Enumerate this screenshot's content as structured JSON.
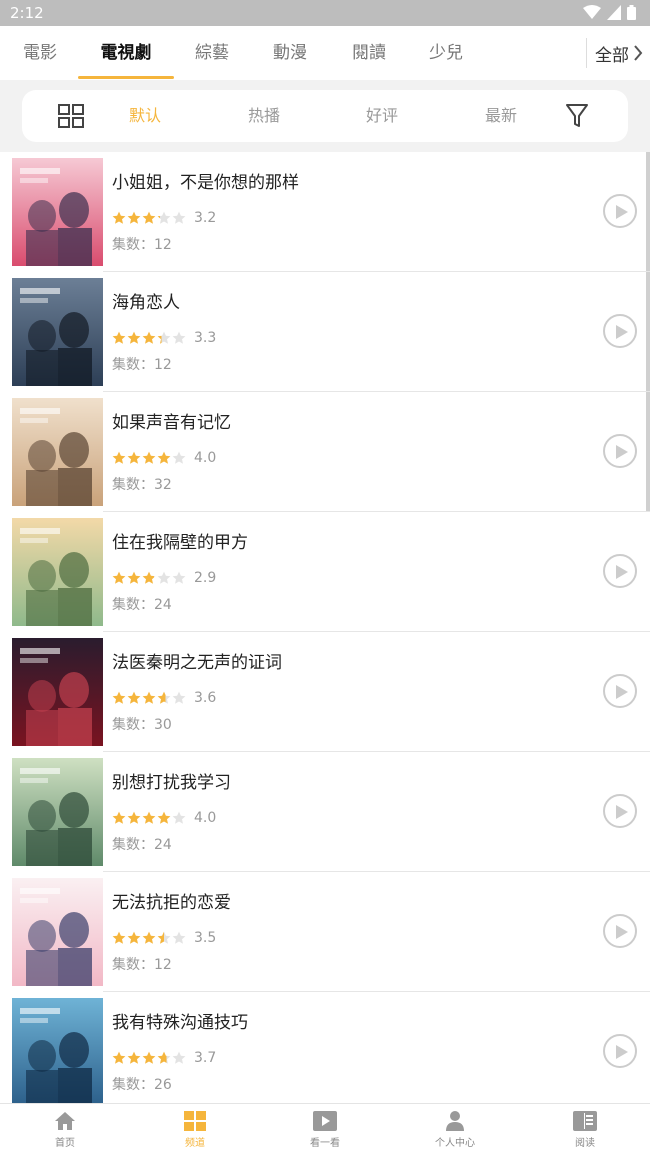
{
  "status_bar": {
    "time": "2:12"
  },
  "category_tabs": {
    "items": [
      "電影",
      "電視劇",
      "綜藝",
      "動漫",
      "閱讀",
      "少兒"
    ],
    "active_index": 1,
    "all_label": "全部"
  },
  "sort_bar": {
    "items": [
      "默认",
      "热播",
      "好评",
      "最新"
    ],
    "active_index": 0
  },
  "shows": [
    {
      "title": "小姐姐，不是你想的那样",
      "rating": 3.2,
      "rating_text": "3.2",
      "episodes": "集数：12"
    },
    {
      "title": "海角恋人",
      "rating": 3.3,
      "rating_text": "3.3",
      "episodes": "集数：12"
    },
    {
      "title": "如果声音有记忆",
      "rating": 4.0,
      "rating_text": "4.0",
      "episodes": "集数：32"
    },
    {
      "title": "住在我隔壁的甲方",
      "rating": 2.9,
      "rating_text": "2.9",
      "episodes": "集数：24"
    },
    {
      "title": "法医秦明之无声的证词",
      "rating": 3.6,
      "rating_text": "3.6",
      "episodes": "集数：30"
    },
    {
      "title": "别想打扰我学习",
      "rating": 4.0,
      "rating_text": "4.0",
      "episodes": "集数：24"
    },
    {
      "title": "无法抗拒的恋爱",
      "rating": 3.5,
      "rating_text": "3.5",
      "episodes": "集数：12"
    },
    {
      "title": "我有特殊沟通技巧",
      "rating": 3.7,
      "rating_text": "3.7",
      "episodes": "集数：26"
    }
  ],
  "bottom_nav": {
    "items": [
      {
        "label": "首页",
        "icon": "home-icon"
      },
      {
        "label": "频道",
        "icon": "channel-grid-icon"
      },
      {
        "label": "看一看",
        "icon": "video-play-icon"
      },
      {
        "label": "个人中心",
        "icon": "user-icon"
      },
      {
        "label": "阅读",
        "icon": "book-icon"
      }
    ],
    "active_index": 1
  },
  "colors": {
    "accent": "#f5b53c",
    "star_on": "#f5b53c",
    "star_off": "#e3e3e3"
  }
}
